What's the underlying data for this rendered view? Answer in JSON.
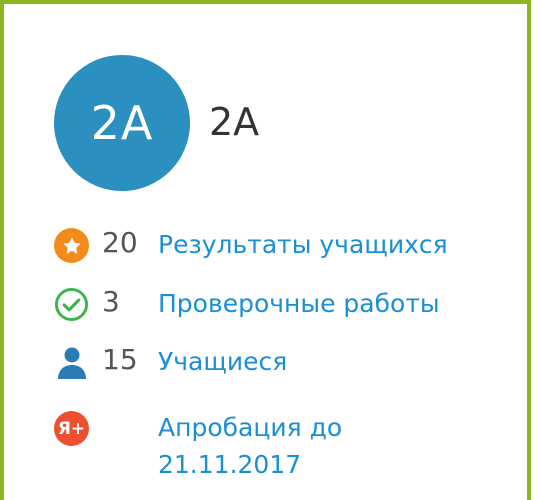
{
  "class": {
    "avatar_text": "2А",
    "name": "2А"
  },
  "stats": [
    {
      "icon": "star-badge-icon",
      "count": "20",
      "label": "Результаты учащихся"
    },
    {
      "icon": "check-circle-icon",
      "count": "3",
      "label": "Проверочные работы"
    },
    {
      "icon": "user-icon",
      "count": "15",
      "label": "Учащиеся"
    }
  ],
  "approbation": {
    "icon": "yandex-plus-icon",
    "icon_text": "Я+",
    "label_line1": "Апробация до",
    "label_line2": "21.11.2017"
  },
  "colors": {
    "border": "#8db51f",
    "avatar": "#2b8fc0",
    "link": "#1a8fd4",
    "star": "#f28a1e",
    "check": "#3bb54a",
    "user": "#2b7cb5",
    "yandex": "#ef4e2f"
  }
}
